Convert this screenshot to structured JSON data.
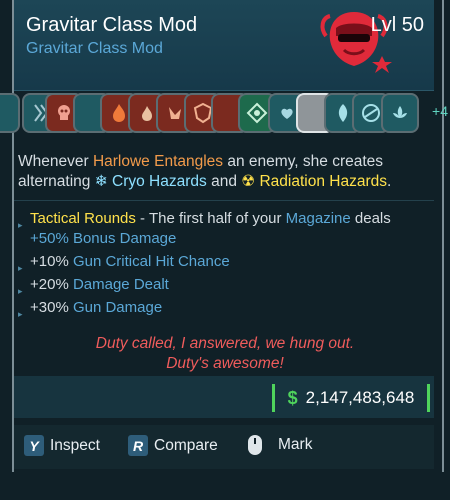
{
  "header": {
    "title": "Gravitar Class Mod",
    "subtitle": "Gravitar Class Mod",
    "level": "Lvl 50"
  },
  "icons": {
    "more_label": "+4",
    "slots": [
      {
        "icon": "tree-skill-icon",
        "color": "teal"
      },
      {
        "icon": "arrows-skill-icon",
        "color": "teal"
      },
      {
        "icon": "skull-skill-icon",
        "color": "red"
      },
      {
        "icon": "blank-skill-icon",
        "color": "teal"
      },
      {
        "icon": "flame-skill-icon",
        "color": "red"
      },
      {
        "icon": "flame-skill-icon",
        "color": "red"
      },
      {
        "icon": "hand-skill-icon",
        "color": "red"
      },
      {
        "icon": "shield-skill-icon",
        "color": "red"
      },
      {
        "icon": "blank-skill-icon",
        "color": "red"
      },
      {
        "icon": "gem-skill-icon",
        "color": "green"
      },
      {
        "icon": "hand-heart-skill-icon",
        "color": "teal"
      },
      {
        "icon": "selected-skill-icon",
        "color": "grey"
      },
      {
        "icon": "leaf-skill-icon",
        "color": "teal"
      },
      {
        "icon": "radar-skill-icon",
        "color": "teal"
      },
      {
        "icon": "lotus-skill-icon",
        "color": "teal"
      }
    ]
  },
  "description": {
    "part1": "Whenever ",
    "harlowe": "Harlowe Entangles",
    "part2": " an enemy, she creates alternating ",
    "cryo_icon": "❄",
    "cryo": "Cryo Hazards",
    "and": " and ",
    "rad_icon": "☢",
    "radiation": "Radiation Hazards",
    "period": "."
  },
  "bullets": {
    "b1_tactical": "Tactical Rounds",
    "b1_a": " - The first half of your ",
    "b1_mag": "Magazine",
    "b1_b": " deals ",
    "b1_bonus": "+50% Bonus Damage",
    "b2_pct": "+10% ",
    "b2_stat": "Gun Critical Hit Chance",
    "b3_pct": "+20% ",
    "b3_stat": "Damage Dealt",
    "b4_pct": "+30% ",
    "b4_stat": "Gun Damage"
  },
  "flavor": {
    "line1": "Duty called, I answered, we hung out.",
    "line2": "Duty's awesome!"
  },
  "price": {
    "symbol": "$",
    "value": "2,147,483,648"
  },
  "actions": {
    "inspect_key": "Y",
    "inspect_label": "Inspect",
    "compare_key": "R",
    "compare_label": "Compare",
    "mark_label": "Mark"
  },
  "colors": {
    "accent_blue": "#5ba8d7",
    "orange": "#f29b4b",
    "yellow": "#ffe14b",
    "cyan": "#8ee0ff",
    "flavor_red": "#f05c5c",
    "money_green": "#4fd45c"
  }
}
